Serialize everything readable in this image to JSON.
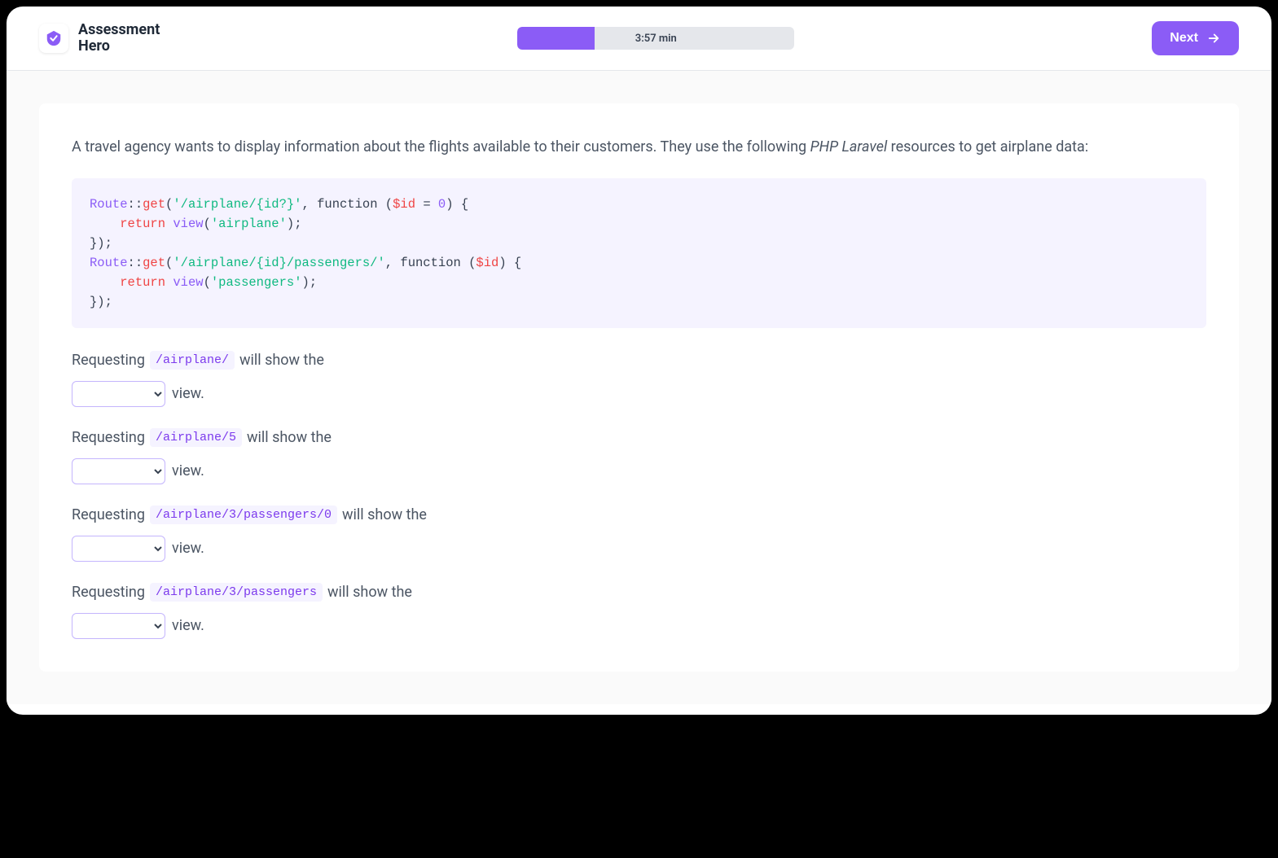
{
  "brand": {
    "line1": "Assessment",
    "line2": "Hero"
  },
  "timer": {
    "text": "3:57 min",
    "progress_percent": 28
  },
  "next_button_label": "Next",
  "question": {
    "intro_before_em": "A travel agency wants to display information about the flights available to their customers. They use the following ",
    "intro_em": "PHP Laravel",
    "intro_after_em": " resources to get airplane data:"
  },
  "code": {
    "l1_class": "Route",
    "l1_sep": "::",
    "l1_method": "get",
    "l1_open": "(",
    "l1_str": "'/airplane/{id?}'",
    "l1_mid": ", function (",
    "l1_var": "$id",
    "l1_eq": " = ",
    "l1_num": "0",
    "l1_end": ") {",
    "l2_indent": "    ",
    "l2_return": "return",
    "l2_sp": " ",
    "l2_view": "view",
    "l2_open": "(",
    "l2_str": "'airplane'",
    "l2_end": ");",
    "l3": "});",
    "l4_class": "Route",
    "l4_sep": "::",
    "l4_method": "get",
    "l4_open": "(",
    "l4_str": "'/airplane/{id}/passengers/'",
    "l4_mid": ", function (",
    "l4_var": "$id",
    "l4_end": ") {",
    "l5_indent": "    ",
    "l5_return": "return",
    "l5_sp": " ",
    "l5_view": "view",
    "l5_open": "(",
    "l5_str": "'passengers'",
    "l5_end": ");",
    "l6": "});"
  },
  "prompts": {
    "requesting": "Requesting ",
    "will_show": " will show the",
    "view_suffix": " view."
  },
  "paths": {
    "p1": "/airplane/",
    "p2": "/airplane/5",
    "p3": "/airplane/3/passengers/0",
    "p4": "/airplane/3/passengers"
  }
}
